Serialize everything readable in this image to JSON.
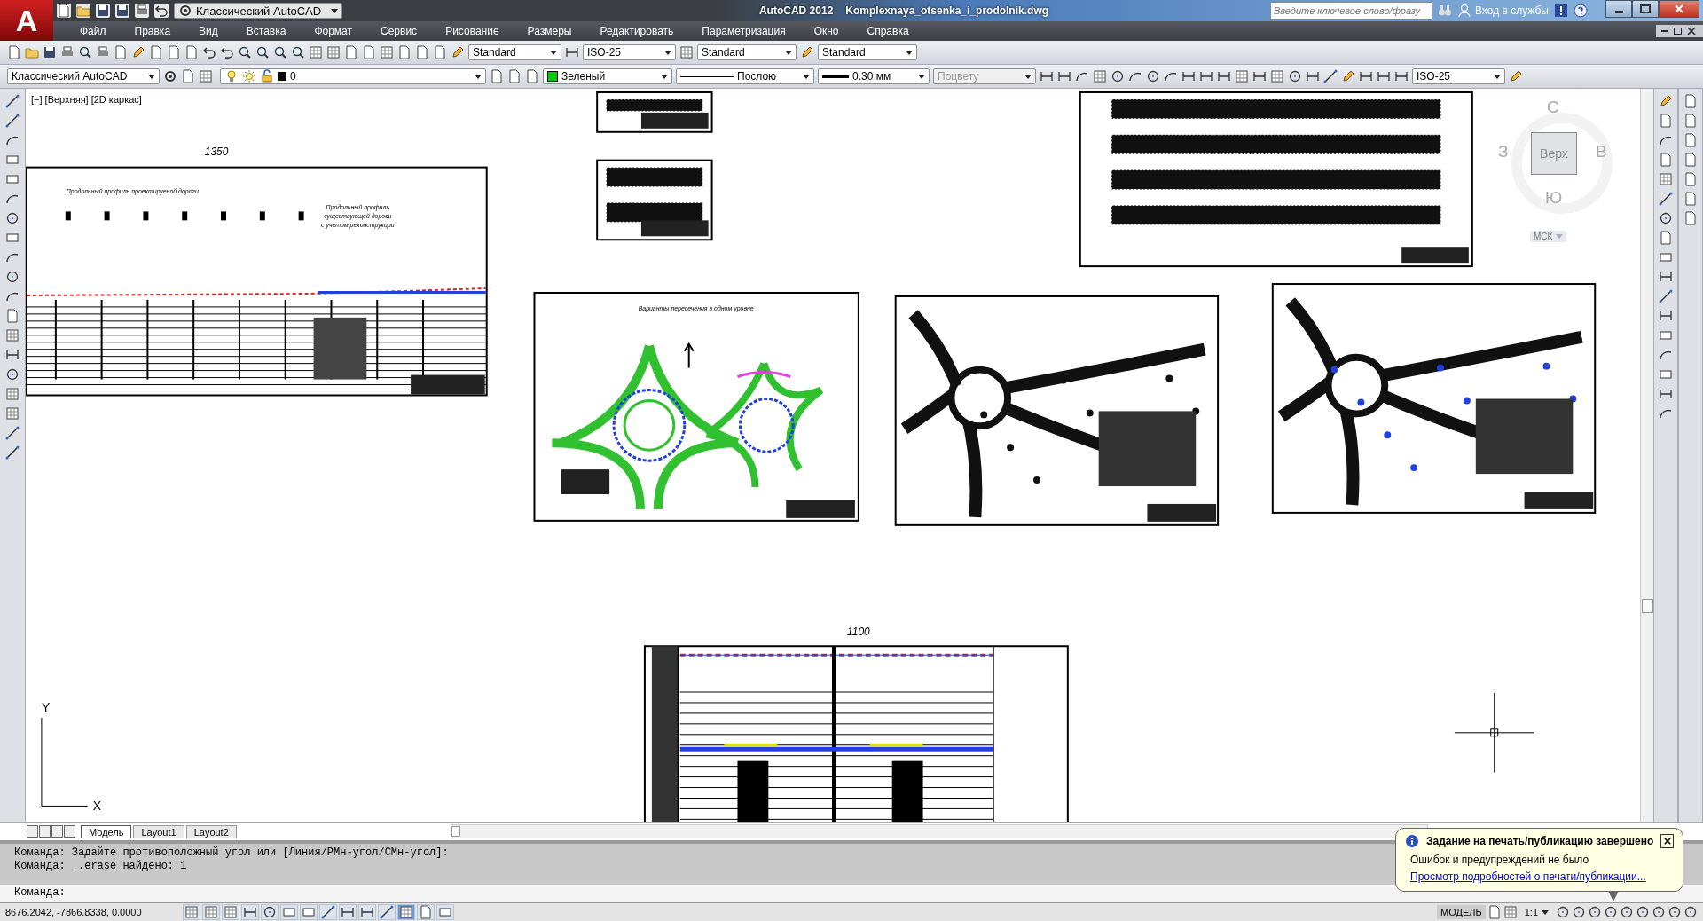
{
  "title_bar": {
    "logo": "A",
    "workspace": "Классический AutoCAD",
    "app": "AutoCAD 2012",
    "file": "Komplexnaya_otsenka_i_prodolnik.dwg",
    "search": {
      "placeholder": "Введите ключевое слово/фразу"
    },
    "sign_in": "Вход в службы"
  },
  "menu": [
    "Файл",
    "Правка",
    "Вид",
    "Вставка",
    "Формат",
    "Сервис",
    "Рисование",
    "Размеры",
    "Редактировать",
    "Параметризация",
    "Окно",
    "Справка"
  ],
  "styles_toolbar": {
    "text_style": "Standard",
    "dim_style": "ISO-25",
    "table_style": "Standard",
    "mleader_style": "Standard"
  },
  "properties_toolbar": {
    "workspace": "Классический AutoCAD",
    "layer": "0",
    "color_name": "Зеленый",
    "linetype": "Послою",
    "lineweight": "0.30 мм",
    "plot_style": {
      "value": "Поцвету",
      "disabled": true
    },
    "dim_style": "ISO-25"
  },
  "viewport_label": "[−] [Верхняя] [2D каркас]",
  "viewcube": {
    "north": "С",
    "south": "Ю",
    "west": "З",
    "east": "В",
    "face": "Верх",
    "ucs": "МСК"
  },
  "sheets": [
    {
      "kind": "profile",
      "label": "1350",
      "texts": [
        "Продольный профиль проектируеной дороги",
        "Продольный профиль",
        "существующей дороги",
        "с учетом реконструкции"
      ]
    },
    {
      "kind": "table"
    },
    {
      "kind": "table"
    },
    {
      "kind": "table"
    },
    {
      "kind": "roundabout",
      "texts": [
        "Варианты пересечения в одном уровне"
      ]
    },
    {
      "kind": "plan"
    },
    {
      "kind": "plan"
    },
    {
      "kind": "profile_cut",
      "label": "1100"
    }
  ],
  "ucs_icon": {
    "x": "X",
    "y": "Y"
  },
  "layout_tabs": [
    {
      "label": "Модель",
      "selected": true
    },
    {
      "label": "Layout1",
      "selected": false
    },
    {
      "label": "Layout2",
      "selected": false
    }
  ],
  "command_history": [
    "Команда: Задайте противоположный угол или [Линия/РМн-угол/СМн-угол]:",
    "Команда: _.erase найдено: 1"
  ],
  "command_prompt": "Команда:",
  "status_bar": {
    "coordinates": "8676.2042, -7866.8338, 0.0000",
    "toggles": [
      {
        "on": false
      },
      {
        "on": false
      },
      {
        "on": false
      },
      {
        "on": false
      },
      {
        "on": false
      },
      {
        "on": false
      },
      {
        "on": false
      },
      {
        "on": false
      },
      {
        "on": false
      },
      {
        "on": false
      },
      {
        "on": false
      },
      {
        "on": true
      },
      {
        "on": false
      },
      {
        "on": false
      }
    ],
    "space": "МОДЕЛЬ",
    "scale": "1:1"
  },
  "notification": {
    "title": "Задание на печать/публикацию завершено",
    "message": "Ошибок и предупреждений не было",
    "link": "Просмотр подробностей о печати/публикации..."
  }
}
